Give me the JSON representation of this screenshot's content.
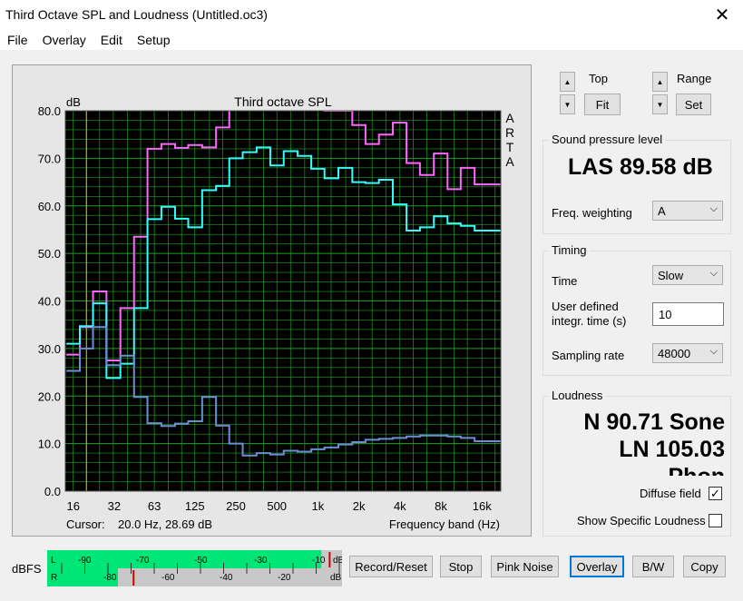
{
  "window": {
    "title": "Third Octave SPL and Loudness (Untitled.oc3)",
    "close_glyph": "✕"
  },
  "menu": [
    "File",
    "Overlay",
    "Edit",
    "Setup"
  ],
  "top_ctrl": {
    "label": "Top",
    "button": "Fit"
  },
  "range_ctrl": {
    "label": "Range",
    "button": "Set"
  },
  "spl": {
    "group": "Sound pressure level",
    "value": "LAS 89.58 dB",
    "weighting_label": "Freq. weighting",
    "weighting": "A"
  },
  "timing": {
    "group": "Timing",
    "time_label": "Time",
    "time": "Slow",
    "user_label_1": "User defined",
    "user_label_2": "integr. time (s)",
    "user_value": "10",
    "rate_label": "Sampling rate",
    "rate": "48000"
  },
  "loudness": {
    "group": "Loudness",
    "line1": "N 90.71 Sone",
    "line2": "LN 105.03",
    "line3": "Phon",
    "diffuse_label": "Diffuse field",
    "diffuse_checked": "✓",
    "specific_label": "Show Specific Loudness"
  },
  "bottom": {
    "dbfs": "dBFS",
    "buttons": [
      "Record/Reset",
      "Stop",
      "Pink Noise",
      "Overlay",
      "B/W",
      "Copy"
    ],
    "meter_top_ticks": [
      "L",
      "-90",
      "-70",
      "-50",
      "-30",
      "-10",
      "dB"
    ],
    "meter_bottom_ticks": [
      "R",
      "-80",
      "-60",
      "-40",
      "-20",
      "dB"
    ],
    "meter_left_level": 0.93,
    "meter_right_level": 0.24,
    "meter_colors": {
      "fill": "#00e676",
      "peak": "#d00000",
      "empty": "#c8c8c8"
    }
  },
  "chart_data": {
    "type": "line",
    "title": "Third octave SPL",
    "ylabel": "dB",
    "xlabel": "Frequency band (Hz)",
    "cursor_label": "Cursor:",
    "cursor_value": "20.0 Hz, 28.69 dB",
    "cursor_freq": 20,
    "watermark": [
      "A",
      "R",
      "T",
      "A"
    ],
    "ylim": [
      0,
      80
    ],
    "y_ticks": [
      "0.0",
      "10.0",
      "20.0",
      "30.0",
      "40.0",
      "50.0",
      "60.0",
      "70.0",
      "80.0"
    ],
    "x_ticks": [
      "16",
      "32",
      "63",
      "125",
      "250",
      "500",
      "1k",
      "2k",
      "4k",
      "8k",
      "16k"
    ],
    "bands": [
      "16",
      "20",
      "25",
      "31.5",
      "40",
      "50",
      "63",
      "80",
      "100",
      "125",
      "160",
      "200",
      "250",
      "315",
      "400",
      "500",
      "630",
      "800",
      "1k",
      "1.25k",
      "1.6k",
      "2k",
      "2.5k",
      "3.15k",
      "4k",
      "5k",
      "6.3k",
      "8k",
      "10k",
      "12.5k",
      "16k",
      "20k"
    ],
    "grid": true,
    "colors": {
      "background": "#000000",
      "grid": "#1f9f1f",
      "cursor": "#c8c832"
    },
    "series": [
      {
        "color": "#ff66ff",
        "values": [
          28.7,
          34.5,
          42,
          27.5,
          38.5,
          53.5,
          72,
          73,
          72.2,
          72.8,
          72.3,
          76.5,
          82,
          82,
          82,
          82,
          82,
          82,
          82,
          80,
          80,
          77,
          73,
          75,
          77.5,
          69,
          66.5,
          71,
          63.5,
          68,
          64.5,
          64.5
        ]
      },
      {
        "color": "#33ffff",
        "values": [
          31,
          34.7,
          39.5,
          23.8,
          26.8,
          38.5,
          57.2,
          59.8,
          57.3,
          55.5,
          63.3,
          64.2,
          70,
          71.3,
          72.3,
          68.5,
          71.5,
          70.5,
          67.8,
          65.8,
          68,
          65,
          64.8,
          65.5,
          60.3,
          54.8,
          55.5,
          57.8,
          56.3,
          55.8,
          54.8,
          54.8
        ]
      },
      {
        "color": "#6a8fd6",
        "values": [
          25.3,
          30,
          34.5,
          26.5,
          28.5,
          19.8,
          14.3,
          13.7,
          14.2,
          14.7,
          19.8,
          13.8,
          10,
          7.5,
          8,
          7.7,
          8.5,
          8.3,
          8.8,
          9.2,
          9.8,
          10.3,
          10.8,
          11,
          11.2,
          11.5,
          11.7,
          11.7,
          11.5,
          11.2,
          10.5,
          10.5
        ]
      }
    ]
  }
}
